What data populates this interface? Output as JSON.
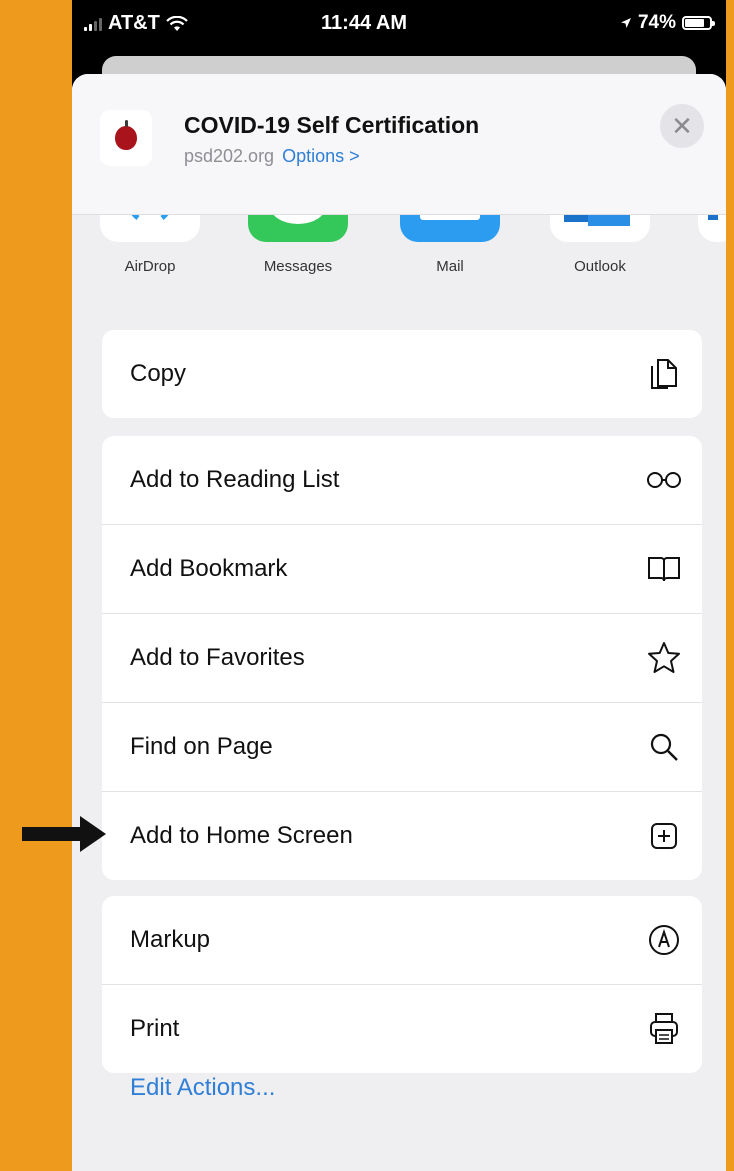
{
  "status_bar": {
    "carrier": "AT&T",
    "time": "11:44 AM",
    "battery": "74%"
  },
  "share_header": {
    "title": "COVID-19 Self Certification",
    "domain": "psd202.org",
    "options_label": "Options >"
  },
  "apps": [
    {
      "label": "AirDrop",
      "icon": "airdrop-icon"
    },
    {
      "label": "Messages",
      "icon": "messages-icon"
    },
    {
      "label": "Mail",
      "icon": "mail-icon"
    },
    {
      "label": "Outlook",
      "icon": "outlook-icon"
    }
  ],
  "actions": {
    "group1": [
      {
        "label": "Copy",
        "icon": "copy-icon"
      }
    ],
    "group2": [
      {
        "label": "Add to Reading List",
        "icon": "glasses-icon"
      },
      {
        "label": "Add Bookmark",
        "icon": "book-icon"
      },
      {
        "label": "Add to Favorites",
        "icon": "star-icon"
      },
      {
        "label": "Find on Page",
        "icon": "search-icon"
      },
      {
        "label": "Add to Home Screen",
        "icon": "plus-square-icon"
      }
    ],
    "group3": [
      {
        "label": "Markup",
        "icon": "markup-icon"
      },
      {
        "label": "Print",
        "icon": "printer-icon"
      }
    ]
  },
  "edit_actions_label": "Edit Actions...",
  "colors": {
    "background": "#ee9a1c",
    "link": "#2f7fd6",
    "messages": "#34c759",
    "mail": "#2b9cf0"
  }
}
